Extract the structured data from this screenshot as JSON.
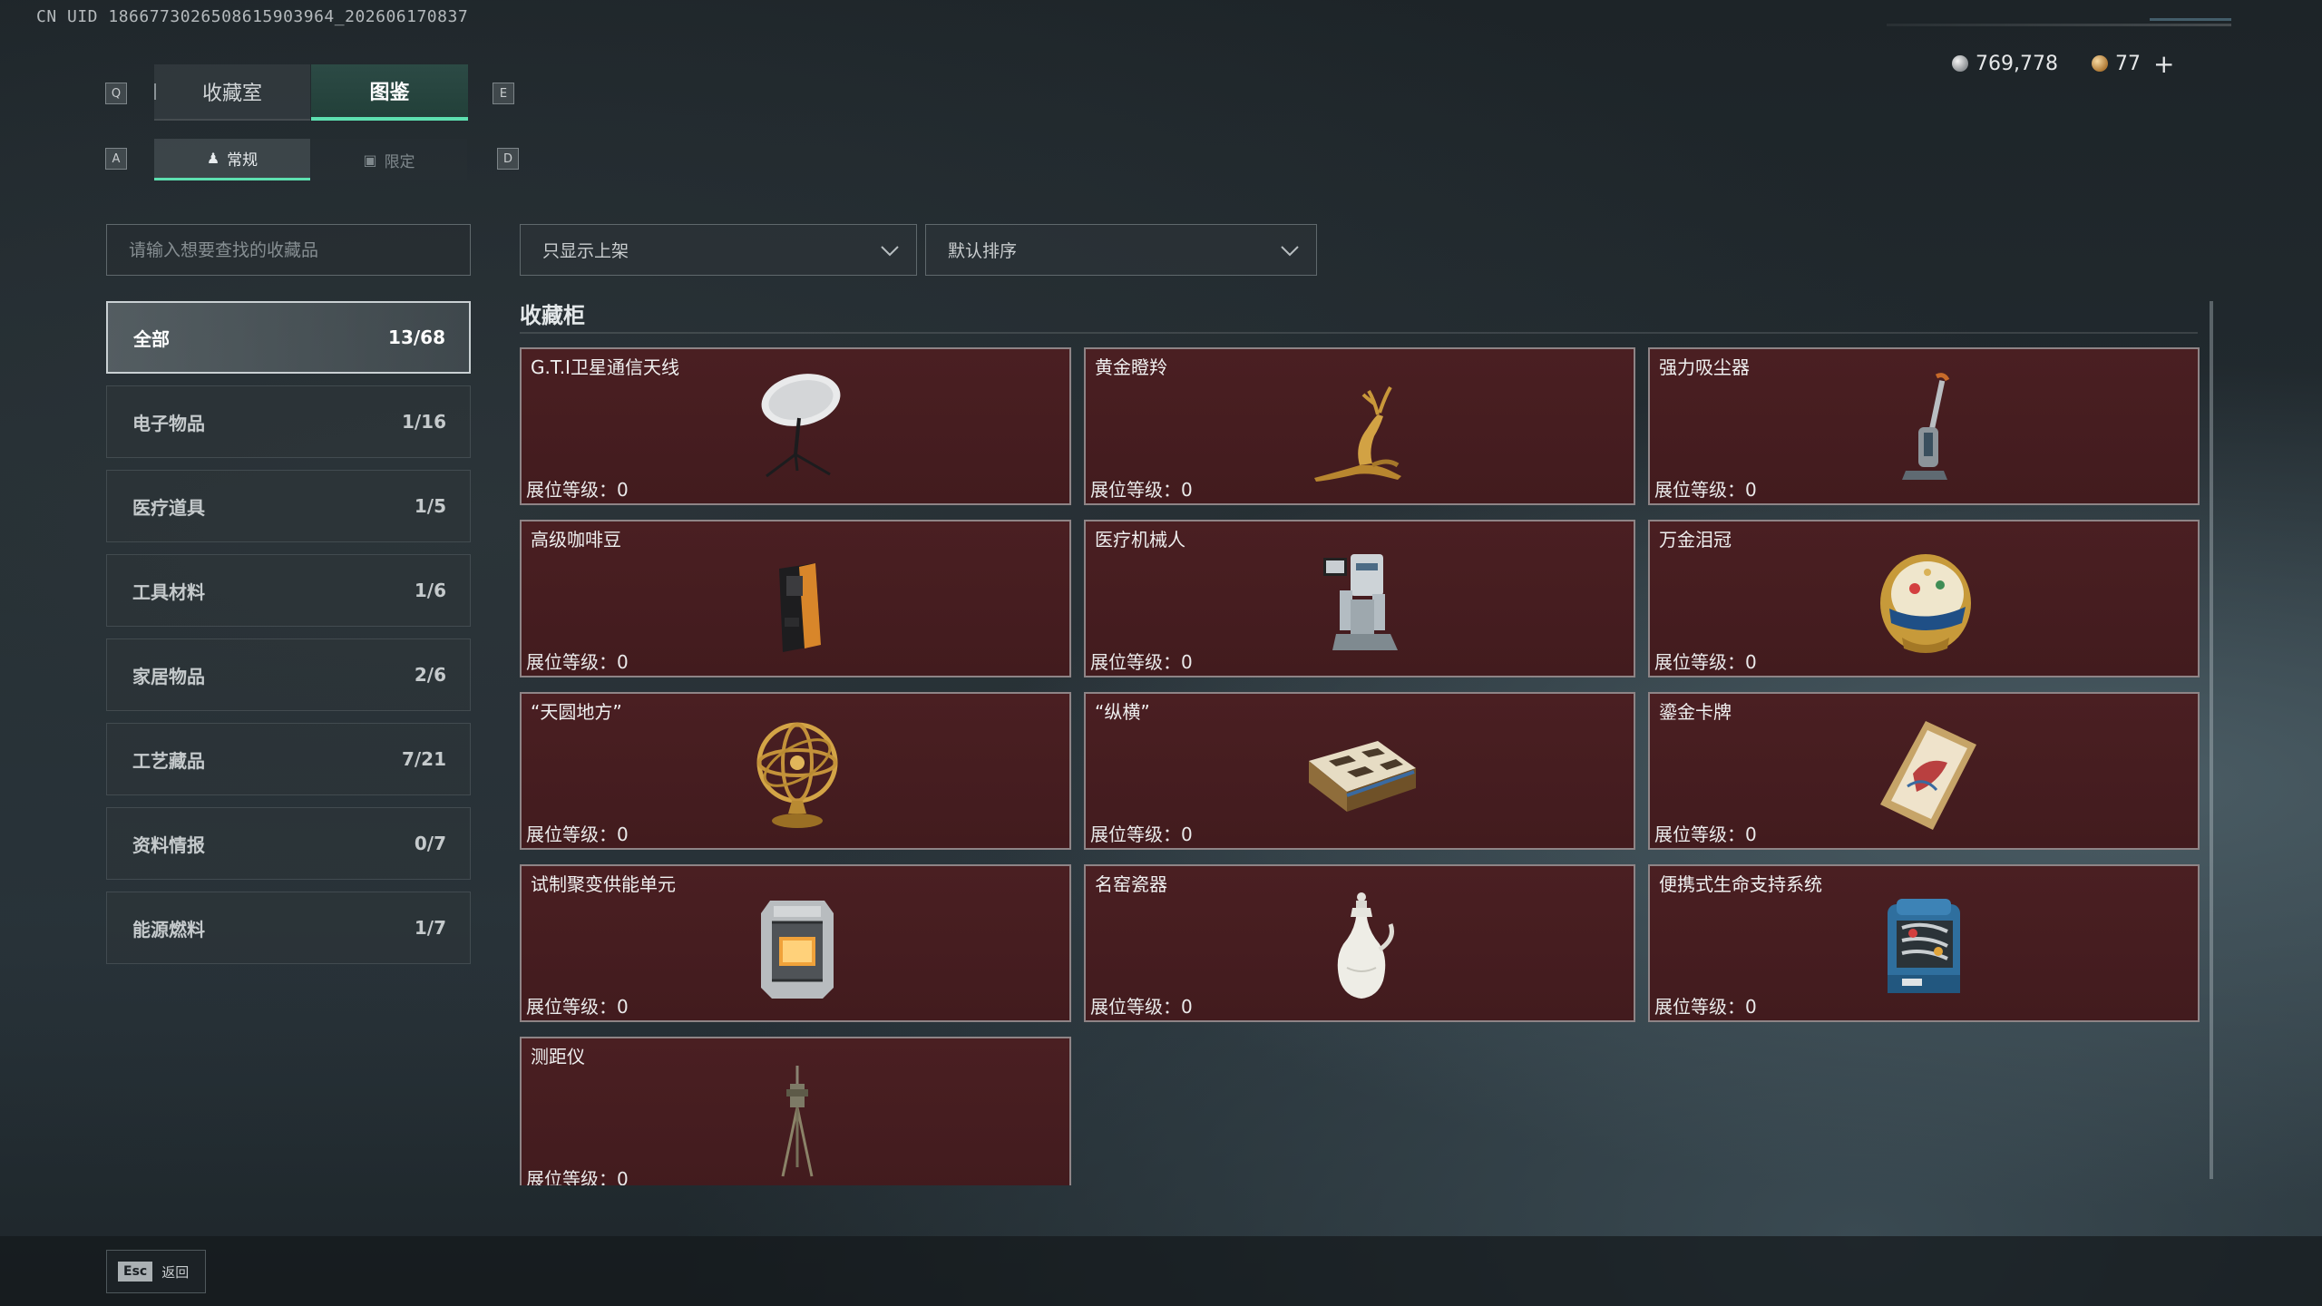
{
  "uid_text": "CN UID 1866773026508615903964_202606170837",
  "currency": {
    "silver": "769,778",
    "gold": "77",
    "plus": "+"
  },
  "keys": {
    "q": "Q",
    "e": "E",
    "a": "A",
    "d": "D"
  },
  "tabs": [
    {
      "label": "收藏室",
      "active": false
    },
    {
      "label": "图鉴",
      "active": true
    }
  ],
  "subtabs": [
    {
      "label": "常规",
      "icon": "person-icon",
      "active": true
    },
    {
      "label": "限定",
      "icon": "image-icon",
      "active": false
    }
  ],
  "search": {
    "placeholder": "请输入想要查找的收藏品"
  },
  "categories": [
    {
      "label": "全部",
      "count": "13/68",
      "active": true
    },
    {
      "label": "电子物品",
      "count": "1/16"
    },
    {
      "label": "医疗道具",
      "count": "1/5"
    },
    {
      "label": "工具材料",
      "count": "1/6"
    },
    {
      "label": "家居物品",
      "count": "2/6"
    },
    {
      "label": "工艺藏品",
      "count": "7/21"
    },
    {
      "label": "资料情报",
      "count": "0/7"
    },
    {
      "label": "能源燃料",
      "count": "1/7"
    }
  ],
  "filters": {
    "shelf": "只显示上架",
    "sort": "默认排序"
  },
  "section_title": "收藏柜",
  "level_label": "展位等级：0",
  "items": [
    {
      "name": "G.T.I卫星通信天线",
      "icon": "satellite-dish-icon"
    },
    {
      "name": "黄金瞪羚",
      "icon": "golden-gazelle-icon"
    },
    {
      "name": "强力吸尘器",
      "icon": "vacuum-cleaner-icon"
    },
    {
      "name": "高级咖啡豆",
      "icon": "coffee-bag-icon"
    },
    {
      "name": "医疗机械人",
      "icon": "medical-robot-icon"
    },
    {
      "name": "万金泪冠",
      "icon": "jeweled-egg-icon"
    },
    {
      "name": "“天圆地方”",
      "icon": "armillary-sphere-icon"
    },
    {
      "name": "“纵横”",
      "icon": "chess-box-icon"
    },
    {
      "name": "鎏金卡牌",
      "icon": "gilded-card-icon"
    },
    {
      "name": "试制聚变供能单元",
      "icon": "fusion-unit-icon"
    },
    {
      "name": "名窑瓷器",
      "icon": "porcelain-vase-icon"
    },
    {
      "name": "便携式生命支持系统",
      "icon": "life-support-icon"
    },
    {
      "name": "测距仪",
      "icon": "rangefinder-tripod-icon"
    }
  ],
  "footer": {
    "esc_key": "Esc",
    "esc_label": "返回"
  }
}
